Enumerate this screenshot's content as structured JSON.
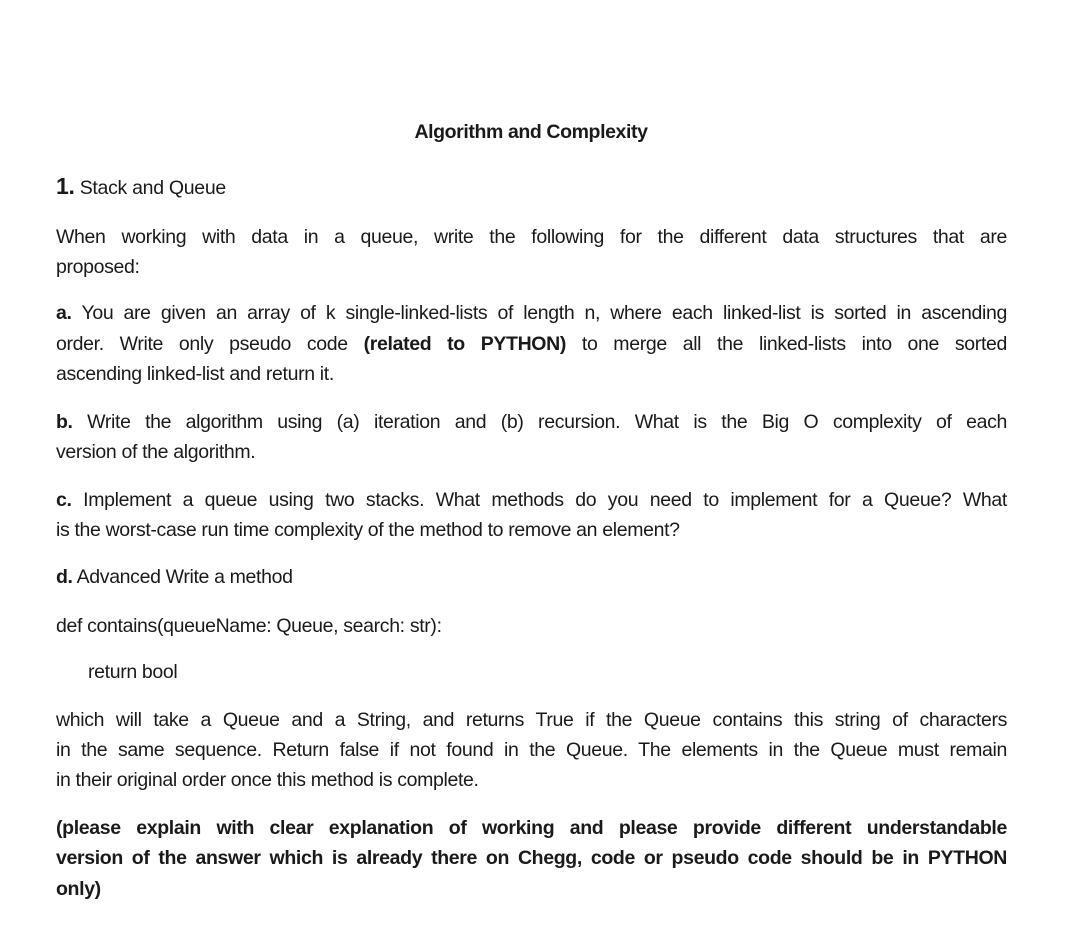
{
  "document": {
    "title": "Algorithm and Complexity",
    "section": {
      "number": "1.",
      "heading": "Stack and Queue"
    },
    "intro": {
      "line1": "When working with data in a queue, write the following for the different data structures that are",
      "line2": "proposed:"
    },
    "part_a": {
      "label": "a.",
      "line1": "You are given an array of k single-linked-lists of length n, where each linked-list is sorted in ascending",
      "line2_pre": "order. Write only pseudo code ",
      "line2_bold": "(related to PYTHON)",
      "line2_post": " to merge all the linked-lists into one sorted",
      "line3": "ascending linked-list and return it."
    },
    "part_b": {
      "label": "b.",
      "line1": "Write the algorithm using (a) iteration and (b) recursion. What is the Big O complexity of each",
      "line2": "version of the algorithm."
    },
    "part_c": {
      "label": "c.",
      "line1": "Implement a queue using two stacks. What methods do you need to implement for a Queue? What",
      "line2": "is the worst-case run time complexity of the method to remove an element?"
    },
    "part_d": {
      "label": "d.",
      "line1": "Advanced Write a method",
      "signature": "def contains(queueName: Queue, search: str):",
      "return_line": "return bool",
      "desc_line1": "which will take a Queue and a String, and returns True if the Queue contains this string of characters",
      "desc_line2": "in the same sequence. Return false if not found in the Queue. The elements in the Queue must remain",
      "desc_line3": "in their original order once this method is complete."
    },
    "note": {
      "line1": "(please explain with clear explanation of working and please provide different understandable",
      "line2": "version of the answer which is already there on Chegg, code or pseudo code should be in PYTHON",
      "line3": "only)"
    }
  }
}
